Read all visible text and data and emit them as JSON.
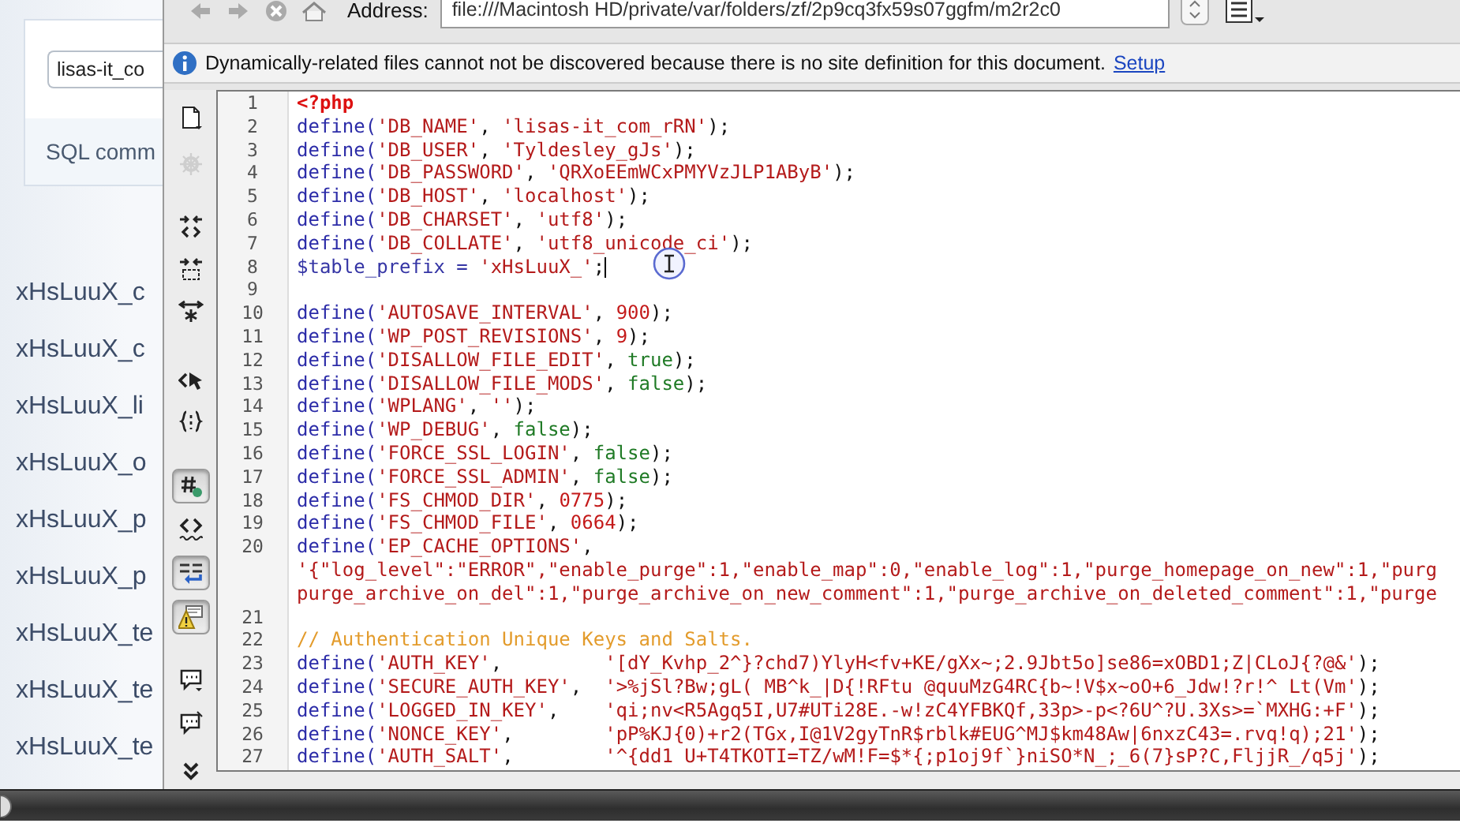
{
  "page": {
    "database_field": {
      "value": "lisas-it_co"
    },
    "sql_label": "SQL comm",
    "tables": [
      "xHsLuuX_c",
      "xHsLuuX_c",
      "xHsLuuX_li",
      "xHsLuuX_o",
      "xHsLuuX_p",
      "xHsLuuX_p",
      "xHsLuuX_te",
      "xHsLuuX_te",
      "xHsLuuX_te"
    ]
  },
  "editor": {
    "toolbar": {
      "address_label": "Address:",
      "address": {
        "value": "file:///Macintosh HD/private/var/folders/zf/2p9cq3fx59s07ggfm/m2r2c0"
      }
    },
    "info_bar": {
      "message": "Dynamically-related files cannot not be discovered because there is no site definition for this document.",
      "link": "Setup"
    },
    "side_toolbar": [
      {
        "selected": false,
        "disabled": false
      },
      {
        "selected": false,
        "disabled": true
      },
      {
        "selected": false,
        "disabled": false
      },
      {
        "selected": false,
        "disabled": false
      },
      {
        "selected": false,
        "disabled": false
      },
      {
        "selected": false,
        "disabled": false
      },
      {
        "selected": false,
        "disabled": false
      },
      {
        "selected": true,
        "disabled": false
      },
      {
        "selected": false,
        "disabled": false
      },
      {
        "selected": true,
        "disabled": false
      },
      {
        "selected": true,
        "disabled": false
      },
      {
        "selected": false,
        "disabled": false
      },
      {
        "selected": false,
        "disabled": false
      },
      {
        "selected": false,
        "disabled": false
      }
    ],
    "lines": [
      {
        "number": "1",
        "tokens": [
          {
            "kind": "tag",
            "text": "<?php"
          }
        ]
      },
      {
        "number": "2",
        "tokens": [
          {
            "kind": "fn",
            "text": "define("
          },
          {
            "kind": "str",
            "text": "'DB_NAME'"
          },
          {
            "kind": "plain",
            "text": ", "
          },
          {
            "kind": "str",
            "text": "'lisas-it_com_rRN'"
          },
          {
            "kind": "plain",
            "text": ");"
          }
        ]
      },
      {
        "number": "3",
        "tokens": [
          {
            "kind": "fn",
            "text": "define("
          },
          {
            "kind": "str",
            "text": "'DB_USER'"
          },
          {
            "kind": "plain",
            "text": ", "
          },
          {
            "kind": "str",
            "text": "'Tyldesley_gJs'"
          },
          {
            "kind": "plain",
            "text": ");"
          }
        ]
      },
      {
        "number": "4",
        "tokens": [
          {
            "kind": "fn",
            "text": "define("
          },
          {
            "kind": "str",
            "text": "'DB_PASSWORD'"
          },
          {
            "kind": "plain",
            "text": ", "
          },
          {
            "kind": "str",
            "text": "'QRXoEEmWCxPMYVzJLP1AByB'"
          },
          {
            "kind": "plain",
            "text": ");"
          }
        ]
      },
      {
        "number": "5",
        "tokens": [
          {
            "kind": "fn",
            "text": "define("
          },
          {
            "kind": "str",
            "text": "'DB_HOST'"
          },
          {
            "kind": "plain",
            "text": ", "
          },
          {
            "kind": "str",
            "text": "'localhost'"
          },
          {
            "kind": "plain",
            "text": ");"
          }
        ]
      },
      {
        "number": "6",
        "tokens": [
          {
            "kind": "fn",
            "text": "define("
          },
          {
            "kind": "str",
            "text": "'DB_CHARSET'"
          },
          {
            "kind": "plain",
            "text": ", "
          },
          {
            "kind": "str",
            "text": "'utf8'"
          },
          {
            "kind": "plain",
            "text": ");"
          }
        ]
      },
      {
        "number": "7",
        "tokens": [
          {
            "kind": "fn",
            "text": "define("
          },
          {
            "kind": "str",
            "text": "'DB_COLLATE'"
          },
          {
            "kind": "plain",
            "text": ", "
          },
          {
            "kind": "str",
            "text": "'utf8_unicode_ci'"
          },
          {
            "kind": "plain",
            "text": ");"
          }
        ]
      },
      {
        "number": "8",
        "caret": true,
        "tokens": [
          {
            "kind": "var",
            "text": "$table_prefix = "
          },
          {
            "kind": "str",
            "text": "'xHsLuuX_'"
          },
          {
            "kind": "plain",
            "text": ";"
          }
        ]
      },
      {
        "number": "9"
      },
      {
        "number": "10",
        "tokens": [
          {
            "kind": "fn",
            "text": "define("
          },
          {
            "kind": "str",
            "text": "'AUTOSAVE_INTERVAL'"
          },
          {
            "kind": "plain",
            "text": ", "
          },
          {
            "kind": "num",
            "text": "900"
          },
          {
            "kind": "plain",
            "text": ");"
          }
        ]
      },
      {
        "number": "11",
        "tokens": [
          {
            "kind": "fn",
            "text": "define("
          },
          {
            "kind": "str",
            "text": "'WP_POST_REVISIONS'"
          },
          {
            "kind": "plain",
            "text": ", "
          },
          {
            "kind": "num",
            "text": "9"
          },
          {
            "kind": "plain",
            "text": ");"
          }
        ]
      },
      {
        "number": "12",
        "tokens": [
          {
            "kind": "fn",
            "text": "define("
          },
          {
            "kind": "str",
            "text": "'DISALLOW_FILE_EDIT'"
          },
          {
            "kind": "plain",
            "text": ", "
          },
          {
            "kind": "bool",
            "text": "true"
          },
          {
            "kind": "plain",
            "text": ");"
          }
        ]
      },
      {
        "number": "13",
        "tokens": [
          {
            "kind": "fn",
            "text": "define("
          },
          {
            "kind": "str",
            "text": "'DISALLOW_FILE_MODS'"
          },
          {
            "kind": "plain",
            "text": ", "
          },
          {
            "kind": "bool",
            "text": "false"
          },
          {
            "kind": "plain",
            "text": ");"
          }
        ]
      },
      {
        "number": "14",
        "tokens": [
          {
            "kind": "fn",
            "text": "define("
          },
          {
            "kind": "str",
            "text": "'WPLANG'"
          },
          {
            "kind": "plain",
            "text": ", "
          },
          {
            "kind": "str",
            "text": "''"
          },
          {
            "kind": "plain",
            "text": ");"
          }
        ]
      },
      {
        "number": "15",
        "tokens": [
          {
            "kind": "fn",
            "text": "define("
          },
          {
            "kind": "str",
            "text": "'WP_DEBUG'"
          },
          {
            "kind": "plain",
            "text": ", "
          },
          {
            "kind": "bool",
            "text": "false"
          },
          {
            "kind": "plain",
            "text": ");"
          }
        ]
      },
      {
        "number": "16",
        "tokens": [
          {
            "kind": "fn",
            "text": "define("
          },
          {
            "kind": "str",
            "text": "'FORCE_SSL_LOGIN'"
          },
          {
            "kind": "plain",
            "text": ", "
          },
          {
            "kind": "bool",
            "text": "false"
          },
          {
            "kind": "plain",
            "text": ");"
          }
        ]
      },
      {
        "number": "17",
        "tokens": [
          {
            "kind": "fn",
            "text": "define("
          },
          {
            "kind": "str",
            "text": "'FORCE_SSL_ADMIN'"
          },
          {
            "kind": "plain",
            "text": ", "
          },
          {
            "kind": "bool",
            "text": "false"
          },
          {
            "kind": "plain",
            "text": ");"
          }
        ]
      },
      {
        "number": "18",
        "tokens": [
          {
            "kind": "fn",
            "text": "define("
          },
          {
            "kind": "str",
            "text": "'FS_CHMOD_DIR'"
          },
          {
            "kind": "plain",
            "text": ", "
          },
          {
            "kind": "num",
            "text": "0775"
          },
          {
            "kind": "plain",
            "text": ");"
          }
        ]
      },
      {
        "number": "19",
        "tokens": [
          {
            "kind": "fn",
            "text": "define("
          },
          {
            "kind": "str",
            "text": "'FS_CHMOD_FILE'"
          },
          {
            "kind": "plain",
            "text": ", "
          },
          {
            "kind": "num",
            "text": "0664"
          },
          {
            "kind": "plain",
            "text": ");"
          }
        ]
      },
      {
        "number": "20",
        "tokens": [
          {
            "kind": "fn",
            "text": "define("
          },
          {
            "kind": "str",
            "text": "'EP_CACHE_OPTIONS'"
          },
          {
            "kind": "plain",
            "text": ","
          }
        ]
      },
      {
        "tokens": [
          {
            "kind": "str",
            "text": "'{\"log_level\":\"ERROR\",\"enable_purge\":1,\"enable_map\":0,\"enable_log\":1,\"purge_homepage_on_new\":1,\"purg"
          }
        ]
      },
      {
        "tokens": [
          {
            "kind": "str",
            "text": "purge_archive_on_del\":1,\"purge_archive_on_new_comment\":1,\"purge_archive_on_deleted_comment\":1,\"purge"
          }
        ]
      },
      {
        "number": "21"
      },
      {
        "number": "22",
        "tokens": [
          {
            "kind": "comment",
            "text": "// Authentication Unique Keys and Salts."
          }
        ]
      },
      {
        "number": "23",
        "tokens": [
          {
            "kind": "fn",
            "text": "define("
          },
          {
            "kind": "str",
            "text": "'AUTH_KEY'"
          },
          {
            "kind": "plain",
            "text": ",         "
          },
          {
            "kind": "str",
            "text": "'[dY_Kvhp_2^}?chd7)YlyH<fv+KE/gXx~;2.9Jbt5o]se86=xOBD1;Z|CLoJ{?@&'"
          },
          {
            "kind": "plain",
            "text": ");"
          }
        ]
      },
      {
        "number": "24",
        "tokens": [
          {
            "kind": "fn",
            "text": "define("
          },
          {
            "kind": "str",
            "text": "'SECURE_AUTH_KEY'"
          },
          {
            "kind": "plain",
            "text": ",  "
          },
          {
            "kind": "str",
            "text": "'>%jSl?Bw;gL( MB^k_|D{!RFtu @quuMzG4RC{b~!V$x~oO+6_Jdw!?r!^ Lt(Vm'"
          },
          {
            "kind": "plain",
            "text": ");"
          }
        ]
      },
      {
        "number": "25",
        "tokens": [
          {
            "kind": "fn",
            "text": "define("
          },
          {
            "kind": "str",
            "text": "'LOGGED_IN_KEY'"
          },
          {
            "kind": "plain",
            "text": ",    "
          },
          {
            "kind": "str",
            "text": "'qi;nv<R5Agq5I,U7#UTi28E.-w!zC4YFBKQf,33p>-p<?6U^?U.3Xs>=`MXHG:+F'"
          },
          {
            "kind": "plain",
            "text": ");"
          }
        ]
      },
      {
        "number": "26",
        "tokens": [
          {
            "kind": "fn",
            "text": "define("
          },
          {
            "kind": "str",
            "text": "'NONCE_KEY'"
          },
          {
            "kind": "plain",
            "text": ",        "
          },
          {
            "kind": "str",
            "text": "'pP%KJ{0)+r2(TGx,I@1V2gyTnR$rblk#EUG^MJ$km48Aw|6nxzC43=.rvq!q);21'"
          },
          {
            "kind": "plain",
            "text": ");"
          }
        ]
      },
      {
        "number": "27",
        "tokens": [
          {
            "kind": "fn",
            "text": "define("
          },
          {
            "kind": "str",
            "text": "'AUTH_SALT'"
          },
          {
            "kind": "plain",
            "text": ",        "
          },
          {
            "kind": "str",
            "text": "'^{dd1 U+T4TKOTI=TZ/wM!F=$*{;p1oj9f`}niSO*N_;_6(7}sP?C,FljjR_/q5j'"
          },
          {
            "kind": "plain",
            "text": ");"
          }
        ]
      }
    ]
  }
}
